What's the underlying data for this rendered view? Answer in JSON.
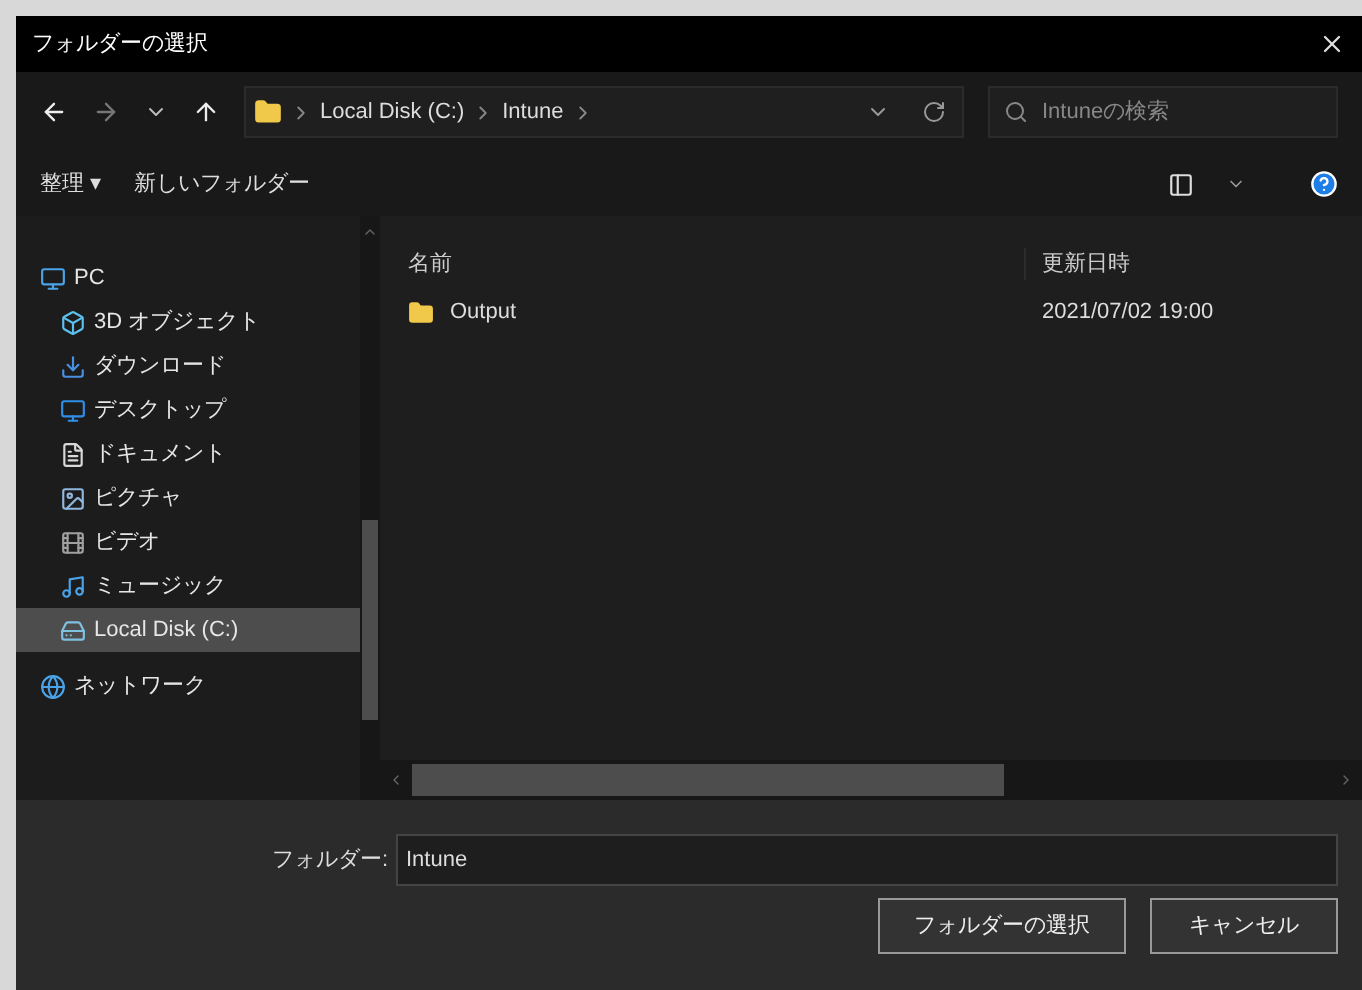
{
  "window": {
    "title": "フォルダーの選択"
  },
  "address_bar": {
    "segments": [
      "Local Disk (C:)",
      "Intune"
    ]
  },
  "search": {
    "placeholder": "Intuneの検索"
  },
  "toolbar": {
    "items": [
      "整理 ▾",
      "新しいフォルダー"
    ]
  },
  "sidebar": {
    "items": [
      {
        "label": "PC",
        "kind": "pc",
        "selected": false,
        "children": [
          {
            "label": "3D オブジェクト",
            "kind": "objects3d",
            "selected": false
          },
          {
            "label": "ダウンロード",
            "kind": "downloads",
            "selected": false
          },
          {
            "label": "デスクトップ",
            "kind": "desktop",
            "selected": false
          },
          {
            "label": "ドキュメント",
            "kind": "documents",
            "selected": false
          },
          {
            "label": "ピクチャ",
            "kind": "pictures",
            "selected": false
          },
          {
            "label": "ビデオ",
            "kind": "videos",
            "selected": false
          },
          {
            "label": "ミュージック",
            "kind": "music",
            "selected": false
          },
          {
            "label": "Local Disk (C:)",
            "kind": "drive",
            "selected": true
          }
        ]
      },
      {
        "label": "ネットワーク",
        "kind": "network",
        "selected": false
      }
    ]
  },
  "file_list": {
    "columns": [
      "名前",
      "更新日時"
    ],
    "rows": [
      {
        "name": "Output",
        "modified": "2021/07/02 19:00",
        "selected": false
      }
    ]
  },
  "footer": {
    "field_label": "フォルダー:",
    "field_value": "Intune",
    "buttons": [
      "フォルダーの選択",
      "キャンセル"
    ]
  }
}
